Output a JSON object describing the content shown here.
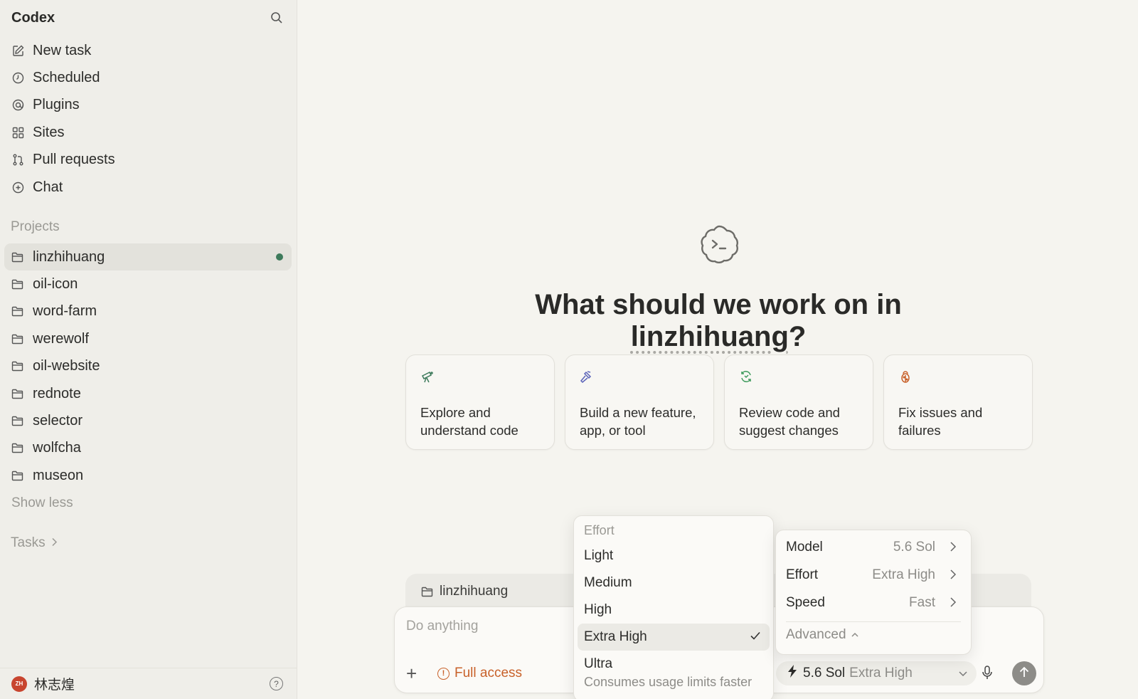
{
  "sidebar": {
    "app_title": "Codex",
    "nav": [
      {
        "label": "New task",
        "icon": "edit-icon"
      },
      {
        "label": "Scheduled",
        "icon": "clock-icon"
      },
      {
        "label": "Plugins",
        "icon": "at-icon"
      },
      {
        "label": "Sites",
        "icon": "grid-icon"
      },
      {
        "label": "Pull requests",
        "icon": "pull-request-icon"
      },
      {
        "label": "Chat",
        "icon": "chat-plus-icon"
      }
    ],
    "projects_label": "Projects",
    "projects": [
      {
        "label": "linzhihuang",
        "active": true
      },
      {
        "label": "oil-icon"
      },
      {
        "label": "word-farm"
      },
      {
        "label": "werewolf"
      },
      {
        "label": "oil-website"
      },
      {
        "label": "rednote"
      },
      {
        "label": "selector"
      },
      {
        "label": "wolfcha"
      },
      {
        "label": "museon"
      }
    ],
    "show_less": "Show less",
    "tasks_label": "Tasks",
    "user": {
      "initials": "ZH",
      "name": "林志煌"
    },
    "help": "?"
  },
  "main": {
    "headline_prefix": "What should we work on in ",
    "headline_project": "linzhihuang",
    "headline_suffix": "?",
    "cards": [
      {
        "label": "Explore and understand code",
        "icon": "telescope-icon",
        "color": "#3d7a5b"
      },
      {
        "label": "Build a new feature, app, or tool",
        "icon": "hammer-icon",
        "color": "#5b63b8"
      },
      {
        "label": "Review code and suggest changes",
        "icon": "refresh-code-icon",
        "color": "#3d9a5b"
      },
      {
        "label": "Fix issues and failures",
        "icon": "bug-icon",
        "color": "#c8612a"
      }
    ]
  },
  "composer": {
    "project_tab": "linzhihuang",
    "placeholder": "Do anything",
    "plus": "+",
    "access": "Full access",
    "model": "5.6 Sol",
    "effort": "Extra High"
  },
  "effort_menu": {
    "title": "Effort",
    "items": [
      "Light",
      "Medium",
      "High",
      "Extra High"
    ],
    "selected": "Extra High",
    "ultra": {
      "label": "Ultra",
      "sub": "Consumes usage limits faster"
    }
  },
  "settings_menu": {
    "rows": [
      {
        "label": "Model",
        "value": "5.6 Sol"
      },
      {
        "label": "Effort",
        "value": "Extra High"
      },
      {
        "label": "Speed",
        "value": "Fast"
      }
    ],
    "advanced": "Advanced"
  },
  "colors": {
    "accent_orange": "#c8612a",
    "active_dot": "#3d7a5b"
  }
}
